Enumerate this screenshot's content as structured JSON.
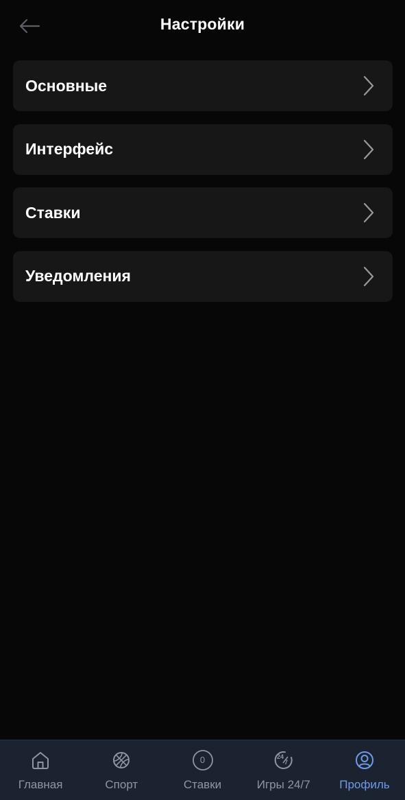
{
  "header": {
    "title": "Настройки",
    "back_icon": "arrow-left-icon"
  },
  "menu": {
    "items": [
      {
        "label": "Основные",
        "icon": "chevron-right-icon"
      },
      {
        "label": "Интерфейс",
        "icon": "chevron-right-icon"
      },
      {
        "label": "Ставки",
        "icon": "chevron-right-icon"
      },
      {
        "label": "Уведомления",
        "icon": "chevron-right-icon"
      }
    ]
  },
  "bottom_nav": {
    "items": [
      {
        "label": "Главная",
        "icon": "home-icon",
        "active": false
      },
      {
        "label": "Спорт",
        "icon": "ball-icon",
        "active": false
      },
      {
        "label": "Ставки",
        "icon": "bets-counter-icon",
        "badge": "0",
        "active": false
      },
      {
        "label": "Игры 24/7",
        "icon": "games-24-7-icon",
        "active": false
      },
      {
        "label": "Профиль",
        "icon": "profile-icon",
        "active": true
      }
    ]
  },
  "colors": {
    "background": "#070707",
    "card": "#171717",
    "nav_background": "#1c2330",
    "nav_inactive": "#8e96a6",
    "nav_active": "#6f9be6"
  }
}
